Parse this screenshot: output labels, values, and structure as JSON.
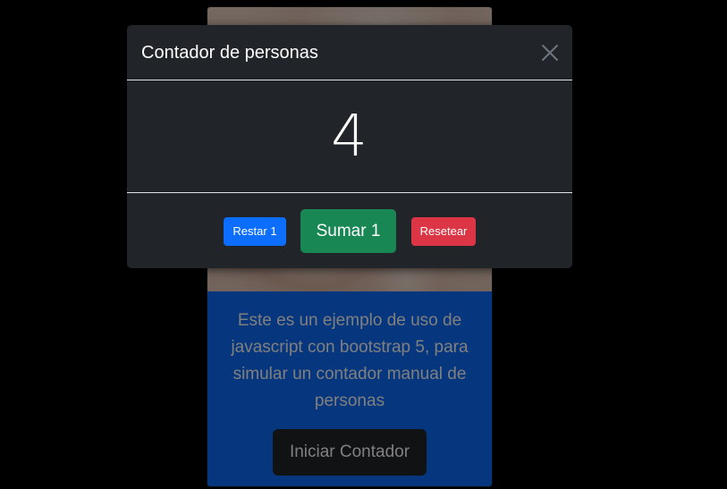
{
  "card": {
    "description": "Este es un ejemplo de uso de javascript con bootstrap 5, para simular un contador manual de personas",
    "start_button_label": "Iniciar Contador"
  },
  "modal": {
    "title": "Contador de personas",
    "close_icon": "close-icon",
    "count": "4",
    "buttons": {
      "subtract_label": "Restar 1",
      "add_label": "Sumar 1",
      "reset_label": "Resetear"
    }
  },
  "colors": {
    "primary": "#0d6efd",
    "success": "#198754",
    "danger": "#dc3545",
    "dark": "#212529"
  }
}
